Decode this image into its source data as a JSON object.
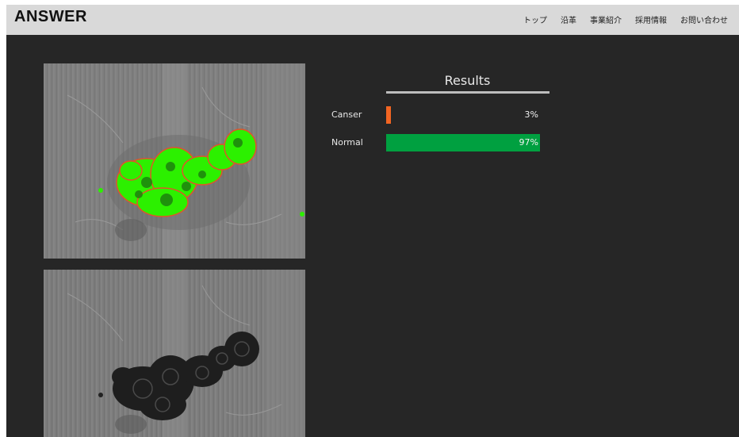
{
  "header": {
    "logo": "ANSWER",
    "nav": [
      "トップ",
      "沿革",
      "事業紹介",
      "採用情報",
      "お問い合わせ"
    ]
  },
  "images": {
    "top": {
      "icon": "segmented-microscope-image"
    },
    "bottom": {
      "icon": "microscope-image"
    }
  },
  "results": {
    "title": "Results",
    "items": [
      {
        "label": "Canser",
        "percent": "3%",
        "value": 0.03,
        "color": "#f26522"
      },
      {
        "label": "Normal",
        "percent": "97%",
        "value": 0.97,
        "color": "#00a040"
      }
    ]
  }
}
